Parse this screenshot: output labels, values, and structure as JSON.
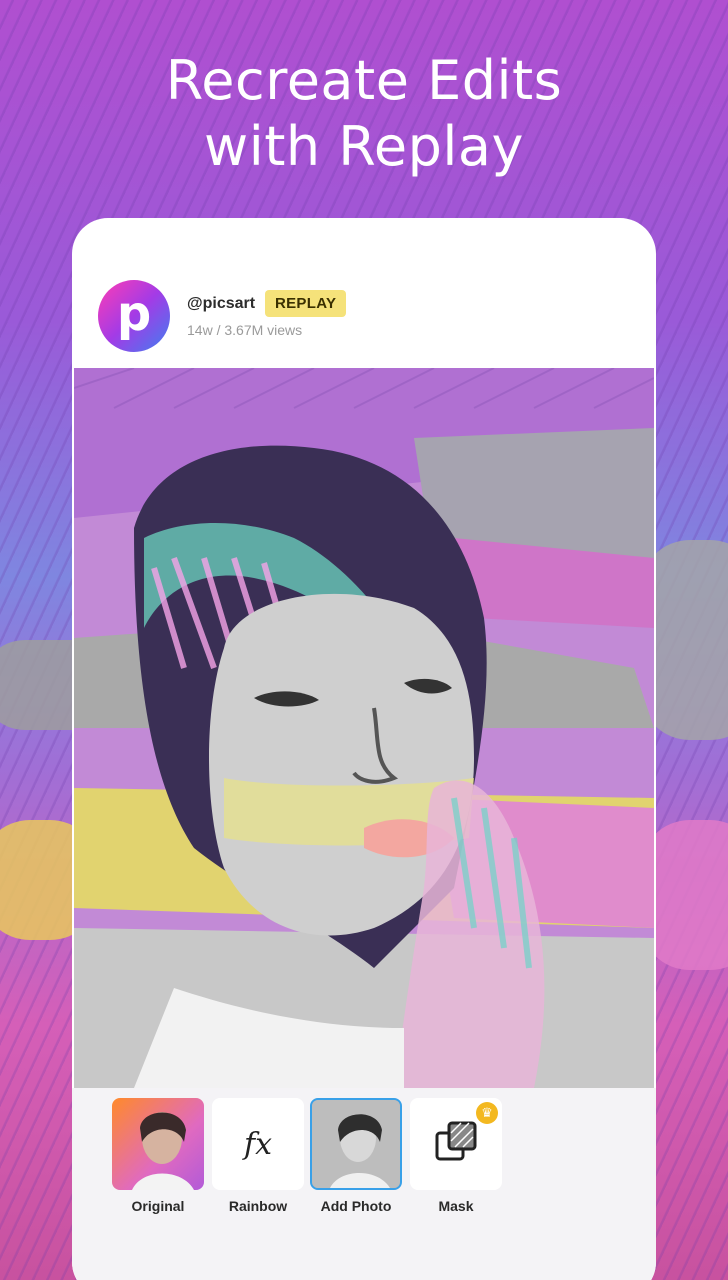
{
  "headline": {
    "line1": "Recreate Edits",
    "line2": "with Replay"
  },
  "post": {
    "username": "@picsart",
    "badge": "REPLAY",
    "stats": "14w / 3.67M views",
    "avatar_letter": "p"
  },
  "tools": [
    {
      "label": "Original",
      "icon": "original-thumbnail"
    },
    {
      "label": "Rainbow",
      "icon": "fx-icon",
      "glyph": "fx"
    },
    {
      "label": "Add Photo",
      "icon": "add-photo-thumbnail",
      "selected": true
    },
    {
      "label": "Mask",
      "icon": "mask-icon",
      "premium": true
    }
  ],
  "colors": {
    "accent_selected": "#39a0e8",
    "badge": "#f5e27a",
    "crown": "#f3b820"
  }
}
